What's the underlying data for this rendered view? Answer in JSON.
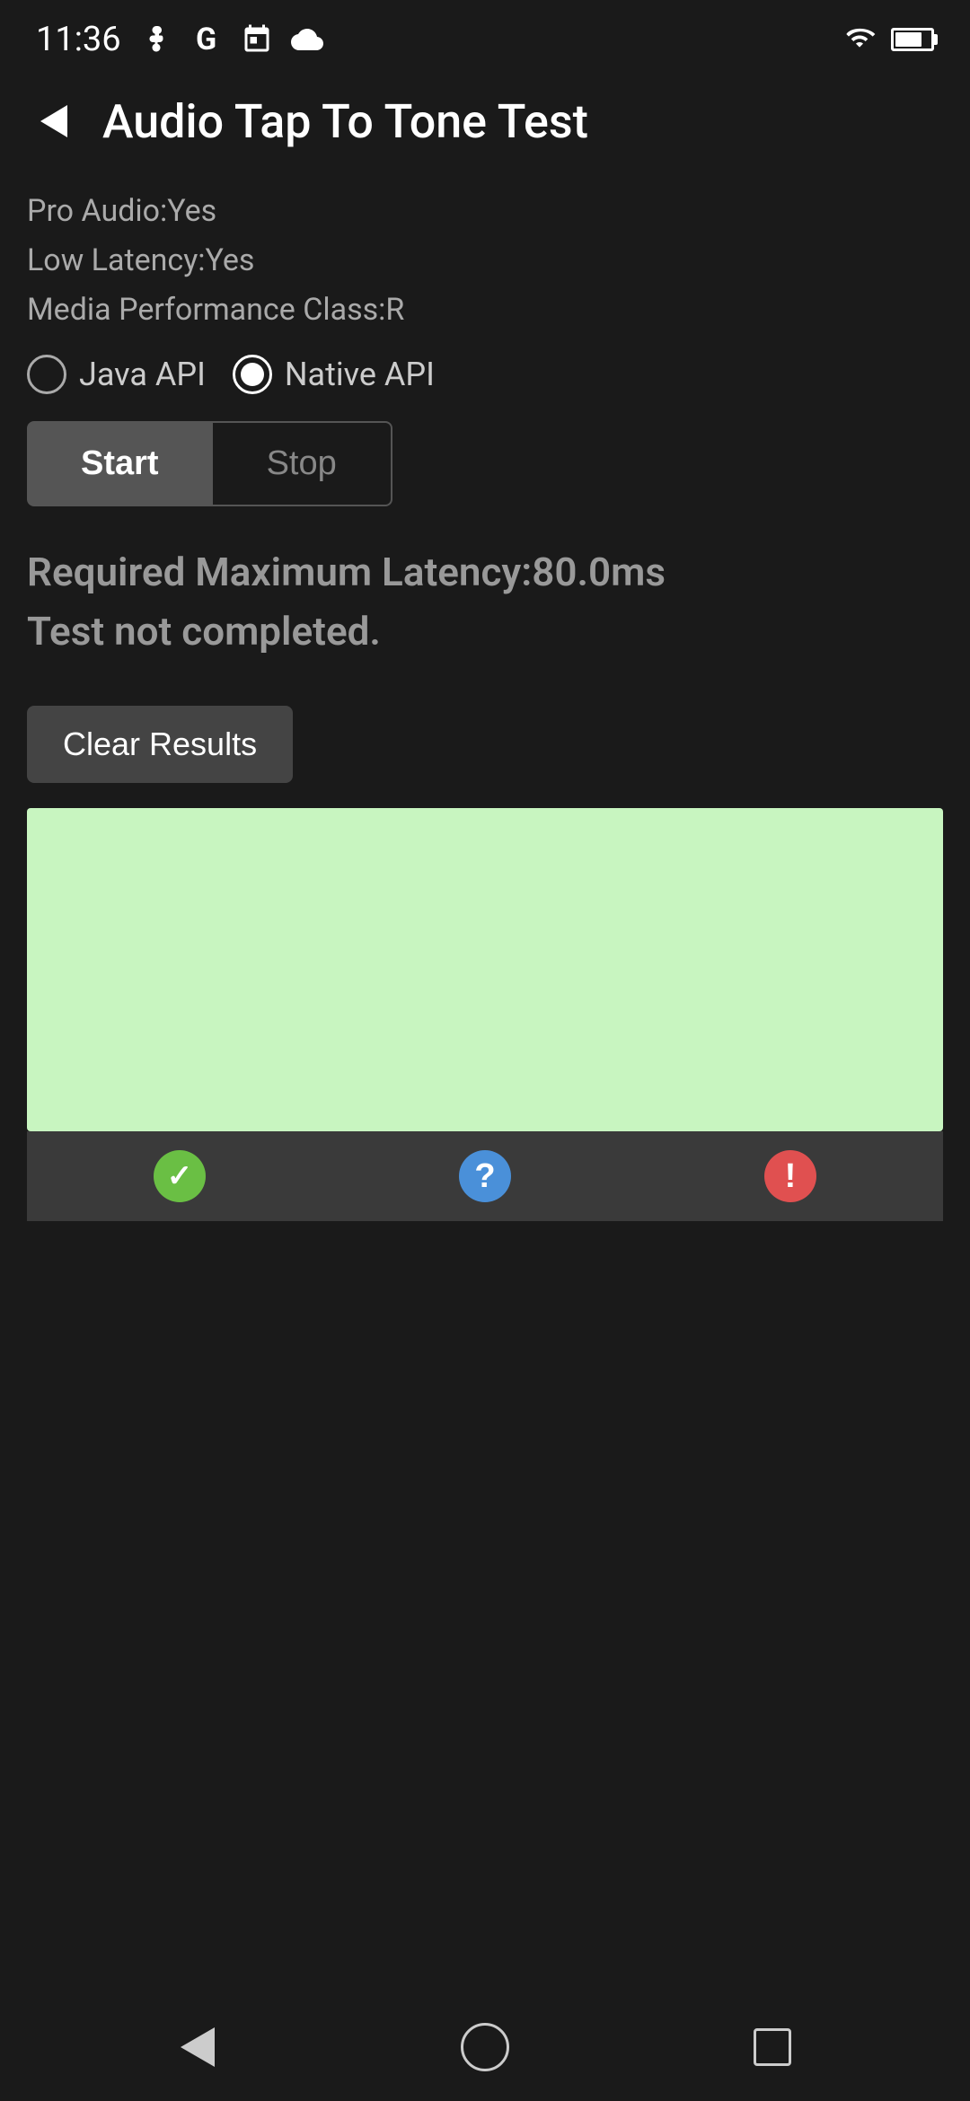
{
  "statusBar": {
    "time": "11:36",
    "icons": [
      "fan-icon",
      "google-icon",
      "calendar-icon",
      "cloud-icon"
    ]
  },
  "appBar": {
    "title": "Audio Tap To Tone Test",
    "backLabel": "back"
  },
  "info": {
    "proAudio": "Pro Audio:Yes",
    "lowLatency": "Low Latency:Yes",
    "mediaPerformance": "Media Performance Class:R"
  },
  "radioGroup": {
    "options": [
      {
        "id": "java",
        "label": "Java API",
        "selected": false
      },
      {
        "id": "native",
        "label": "Native API",
        "selected": true
      }
    ]
  },
  "buttons": {
    "start": "Start",
    "stop": "Stop"
  },
  "statusMessage": {
    "line1": "Required Maximum Latency:80.0ms",
    "line2": "Test not completed."
  },
  "clearResults": {
    "label": "Clear Results"
  },
  "actionButtons": {
    "pass": "✓",
    "unknown": "?",
    "fail": "!"
  },
  "navBar": {
    "back": "back",
    "home": "home",
    "recent": "recent"
  }
}
